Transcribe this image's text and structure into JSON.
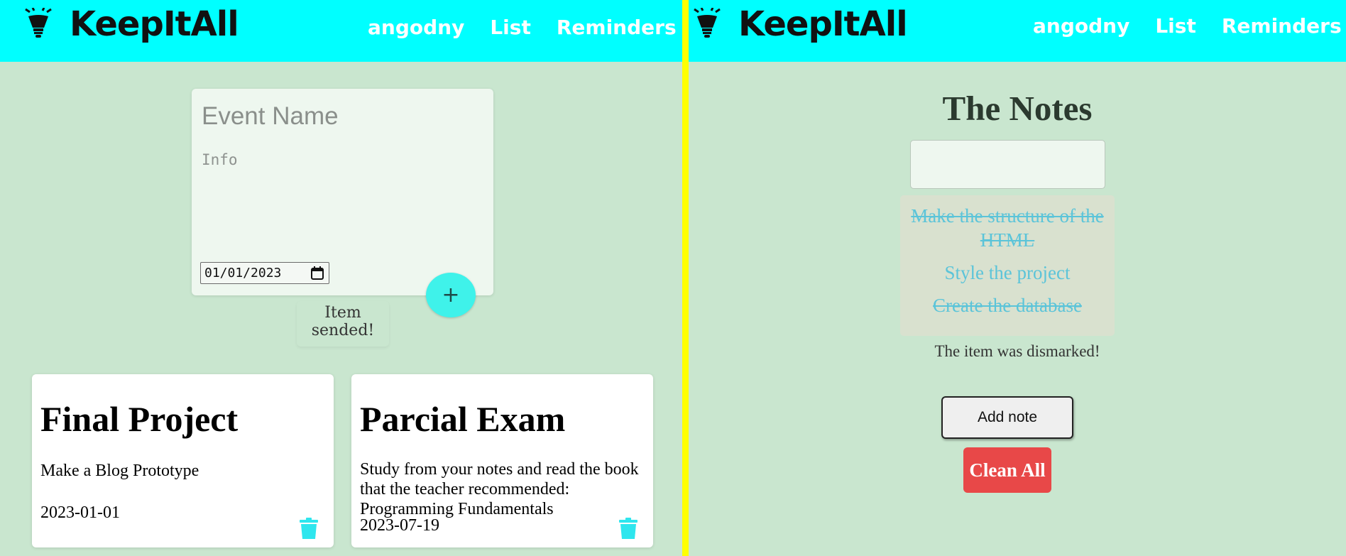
{
  "left": {
    "nav": {
      "brand": "KeepItAll",
      "brand_icon": "lightbulb-icon",
      "links": [
        "angodny",
        "List",
        "Reminders"
      ]
    },
    "event_form": {
      "name_placeholder": "Event Name",
      "info_placeholder": "Info",
      "date_value": "01/01/2023",
      "add_label": "+"
    },
    "toast": "Item sended!",
    "cards": [
      {
        "title": "Final Project",
        "info": "Make a Blog Prototype",
        "date": "2023-01-01",
        "icon": "trash-icon"
      },
      {
        "title": "Parcial Exam",
        "info": "Study from your notes and read the book that the teacher recommended: Programming Fundamentals",
        "date": "2023-07-19",
        "icon": "trash-icon"
      }
    ]
  },
  "right": {
    "nav": {
      "brand": "KeepItAll",
      "brand_icon": "lightbulb-icon",
      "links": [
        "angodny",
        "List",
        "Reminders"
      ]
    },
    "title": "The Notes",
    "note_input_value": "",
    "notes": [
      {
        "text": "Make the structure of the HTML",
        "done": true
      },
      {
        "text": "Style the project",
        "done": false
      },
      {
        "text": "Create the database",
        "done": true
      }
    ],
    "status": "The item was dismarked!",
    "add_note_label": "Add note",
    "clean_all_label": "Clean All"
  },
  "colors": {
    "navbar": "#00ffff",
    "background": "#c9e6cf",
    "divider": "#ffff00",
    "accent": "#3ff2ea",
    "note_text": "#5bc4d9",
    "danger": "#e84848"
  }
}
